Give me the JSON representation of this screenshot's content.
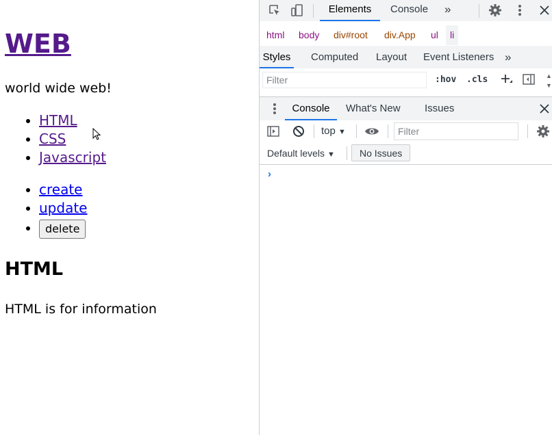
{
  "page": {
    "title": "WEB",
    "tagline": "world wide web!",
    "topics": [
      "HTML",
      "CSS",
      "Javascript"
    ],
    "controls": {
      "create": "create",
      "update": "update",
      "delete": "delete"
    },
    "article_title": "HTML",
    "article_body": "HTML is for information"
  },
  "devtools": {
    "main_tabs": [
      "Elements",
      "Console"
    ],
    "more_glyph": "»",
    "breadcrumbs": [
      {
        "text": "html",
        "kind": "tag"
      },
      {
        "text": "body",
        "kind": "tag"
      },
      {
        "text": "div#root",
        "kind": "id"
      },
      {
        "text": "div.App",
        "kind": "id"
      },
      {
        "text": "ul",
        "kind": "tag"
      },
      {
        "text": "li",
        "kind": "sel"
      }
    ],
    "style_tabs": [
      "Styles",
      "Computed",
      "Layout",
      "Event Listeners"
    ],
    "styles_filter_placeholder": "Filter",
    "hov": ":hov",
    "cls": ".cls",
    "drawer_tabs": [
      "Console",
      "What's New",
      "Issues"
    ],
    "context": "top",
    "console_filter_placeholder": "Filter",
    "levels": "Default levels",
    "no_issues": "No Issues",
    "prompt_glyph": "›",
    "accent": "#1a73e8",
    "tag_color": "#881280",
    "id_color": "#994500"
  }
}
